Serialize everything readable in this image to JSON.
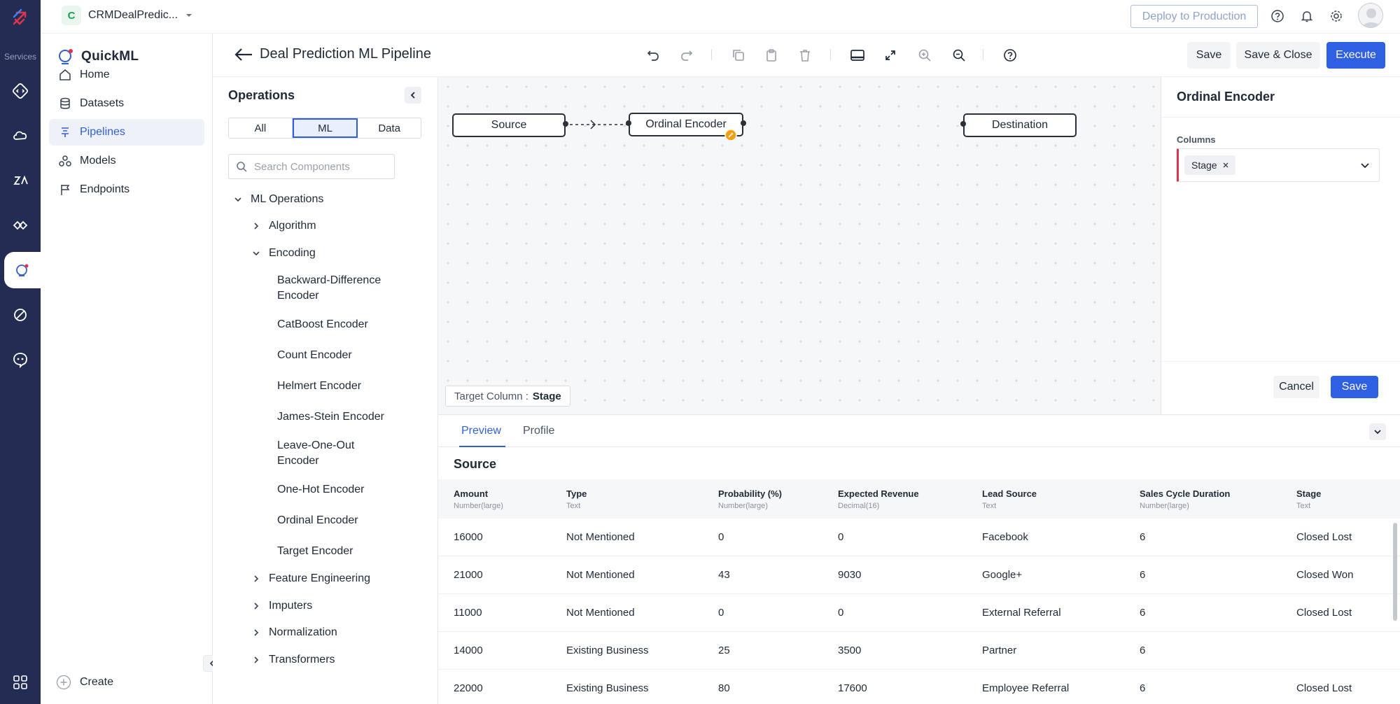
{
  "rail": {
    "services_label": "Services"
  },
  "topbar": {
    "project_initial": "C",
    "project_name": "CRMDealPredic...",
    "deploy_label": "Deploy to Production"
  },
  "nav": {
    "brand": "QuickML",
    "items": [
      {
        "label": "Home",
        "icon": "home-icon"
      },
      {
        "label": "Datasets",
        "icon": "database-icon"
      },
      {
        "label": "Pipelines",
        "icon": "pipeline-icon"
      },
      {
        "label": "Models",
        "icon": "models-icon"
      },
      {
        "label": "Endpoints",
        "icon": "flag-icon"
      }
    ],
    "create_label": "Create"
  },
  "titlebar": {
    "title": "Deal Prediction ML Pipeline",
    "save_label": "Save",
    "save_close_label": "Save & Close",
    "execute_label": "Execute"
  },
  "operations": {
    "heading": "Operations",
    "segments": [
      "All",
      "ML",
      "Data"
    ],
    "active_segment": "ML",
    "search_placeholder": "Search Components",
    "root": "ML Operations",
    "algorithm": "Algorithm",
    "encoding": "Encoding",
    "encoders": [
      "Backward-Difference Encoder",
      "CatBoost Encoder",
      "Count Encoder",
      "Helmert Encoder",
      "James-Stein Encoder",
      "Leave-One-Out Encoder",
      "One-Hot Encoder",
      "Ordinal Encoder",
      "Target Encoder"
    ],
    "feature_engineering": "Feature Engineering",
    "imputers": "Imputers",
    "normalization": "Normalization",
    "transformers": "Transformers"
  },
  "canvas": {
    "nodes": {
      "source": "Source",
      "ordinal": "Ordinal Encoder",
      "destination": "Destination"
    },
    "target_key": "Target Column :",
    "target_value": "Stage"
  },
  "config": {
    "title": "Ordinal Encoder",
    "columns_label": "Columns",
    "chip": "Stage",
    "cancel_label": "Cancel",
    "save_label": "Save"
  },
  "preview": {
    "tabs": [
      "Preview",
      "Profile"
    ],
    "active_tab": "Preview",
    "source_title": "Source",
    "columns": [
      {
        "name": "Amount",
        "type": "Number(large)"
      },
      {
        "name": "Type",
        "type": "Text"
      },
      {
        "name": "Probability (%)",
        "type": "Number(large)"
      },
      {
        "name": "Expected Revenue",
        "type": "Decimal(16)"
      },
      {
        "name": "Lead Source",
        "type": "Text"
      },
      {
        "name": "Sales Cycle Duration",
        "type": "Number(large)"
      },
      {
        "name": "Stage",
        "type": "Text"
      }
    ],
    "rows": [
      [
        "16000",
        "Not Mentioned",
        "0",
        "0",
        "Facebook",
        "6",
        "Closed Lost"
      ],
      [
        "21000",
        "Not Mentioned",
        "43",
        "9030",
        "Google+",
        "6",
        "Closed Won"
      ],
      [
        "11000",
        "Not Mentioned",
        "0",
        "0",
        "External Referral",
        "6",
        "Closed Lost"
      ],
      [
        "14000",
        "Existing Business",
        "25",
        "3500",
        "Partner",
        "6",
        ""
      ],
      [
        "22000",
        "Existing Business",
        "80",
        "17600",
        "Employee Referral",
        "6",
        "Closed Lost"
      ]
    ]
  },
  "colors": {
    "rail": "#232c52",
    "primary": "#2f5fe3",
    "accent_link": "#2f5fd8"
  }
}
